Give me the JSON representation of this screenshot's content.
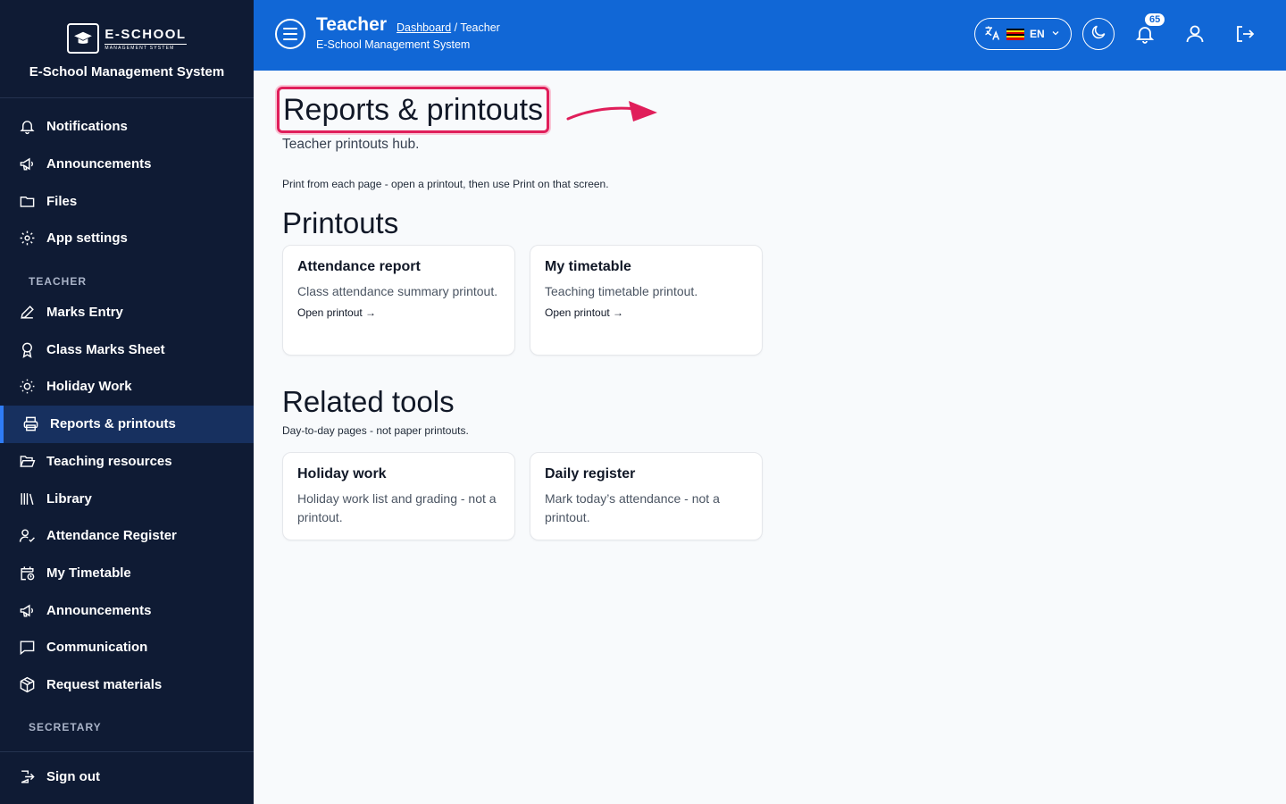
{
  "app": {
    "logo_main": "E-SCHOOL",
    "logo_sub": "MANAGEMENT SYSTEM",
    "name": "E-School Management System"
  },
  "sidebar": {
    "items_top": [
      {
        "label": "Notifications",
        "icon": "bell-icon"
      },
      {
        "label": "Announcements",
        "icon": "megaphone-icon"
      },
      {
        "label": "Files",
        "icon": "folder-icon"
      },
      {
        "label": "App settings",
        "icon": "gear-icon"
      }
    ],
    "section_teacher": "TEACHER",
    "items_teacher": [
      {
        "label": "Marks Entry",
        "icon": "pencil-icon"
      },
      {
        "label": "Class Marks Sheet",
        "icon": "award-icon"
      },
      {
        "label": "Holiday Work",
        "icon": "sun-icon"
      },
      {
        "label": "Reports & printouts",
        "icon": "printer-icon",
        "active": true
      },
      {
        "label": "Teaching resources",
        "icon": "folder-open-icon"
      },
      {
        "label": "Library",
        "icon": "library-icon"
      },
      {
        "label": "Attendance Register",
        "icon": "user-check-icon"
      },
      {
        "label": "My Timetable",
        "icon": "calendar-clock-icon"
      },
      {
        "label": "Announcements",
        "icon": "megaphone-icon"
      },
      {
        "label": "Communication",
        "icon": "message-icon"
      },
      {
        "label": "Request materials",
        "icon": "package-icon"
      }
    ],
    "section_secretary": "SECRETARY",
    "sign_out": "Sign out"
  },
  "header": {
    "title": "Teacher",
    "breadcrumb_link": "Dashboard",
    "breadcrumb_rest": " / Teacher",
    "subtitle": "E-School Management System",
    "language": "EN",
    "notification_count": "65"
  },
  "main": {
    "page_title": "Reports & printouts",
    "page_subtitle": "Teacher printouts hub.",
    "hint": "Print from each page - open a printout, then use Print on that screen.",
    "printouts_heading": "Printouts",
    "printouts": [
      {
        "title": "Attendance report",
        "desc": "Class attendance summary printout.",
        "link": "Open printout →"
      },
      {
        "title": "My timetable",
        "desc": "Teaching timetable printout.",
        "link": "Open printout →"
      }
    ],
    "related_heading": "Related tools",
    "related_subtitle": "Day-to-day pages - not paper printouts.",
    "related": [
      {
        "title": "Holiday work",
        "desc": "Holiday work list and grading - not a printout."
      },
      {
        "title": "Daily register",
        "desc": "Mark today’s attendance - not a printout."
      }
    ]
  },
  "colors": {
    "sidebar_bg": "#0f1b34",
    "header_bg": "#1167d6",
    "active_item_bg": "#17305f",
    "highlight": "#e01e5a"
  }
}
